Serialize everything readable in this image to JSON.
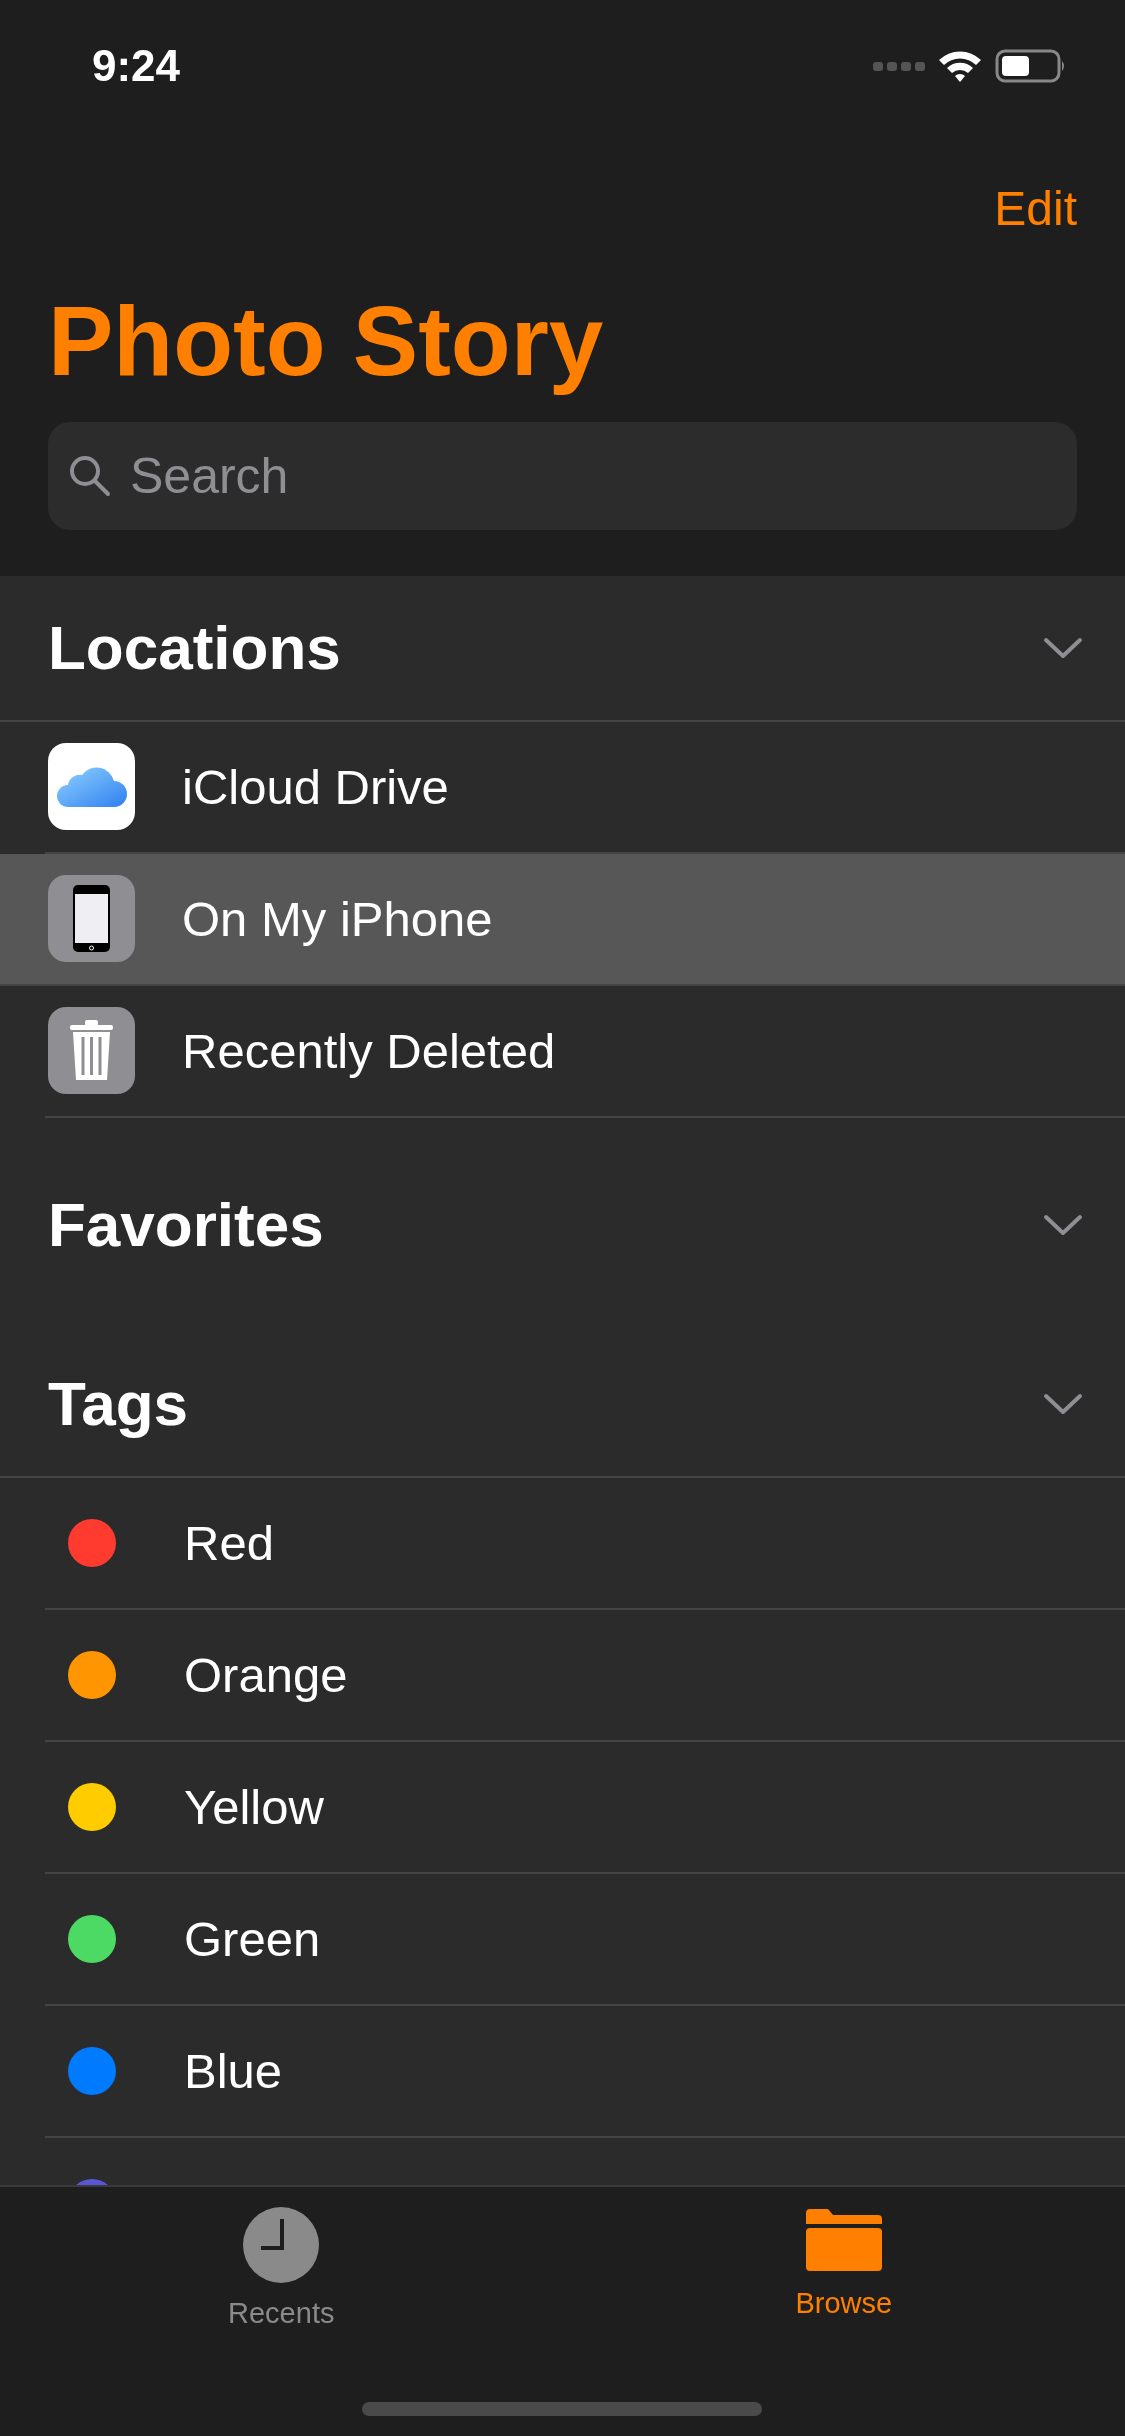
{
  "status_bar": {
    "time": "9:24"
  },
  "nav": {
    "edit": "Edit",
    "title": "Photo Story"
  },
  "search": {
    "placeholder": "Search"
  },
  "sections": [
    {
      "title": "Locations",
      "kind": "locations",
      "items": [
        {
          "label": "iCloud Drive",
          "selected": false
        },
        {
          "label": "On My iPhone",
          "selected": true
        },
        {
          "label": "Recently Deleted",
          "selected": false
        }
      ]
    },
    {
      "title": "Favorites",
      "kind": "favorites"
    },
    {
      "title": "Tags",
      "kind": "tags",
      "items": [
        {
          "label": "Red",
          "color": "#ff3b30"
        },
        {
          "label": "Orange",
          "color": "#ff9500"
        },
        {
          "label": "Yellow",
          "color": "#ffcc00"
        },
        {
          "label": "Green",
          "color": "#4cd964"
        },
        {
          "label": "Blue",
          "color": "#007aff"
        },
        {
          "color": "#5856d6"
        }
      ]
    }
  ],
  "tab_bar": [
    {
      "label": "Recents",
      "selected": false
    },
    {
      "label": "Browse",
      "selected": true
    }
  ]
}
